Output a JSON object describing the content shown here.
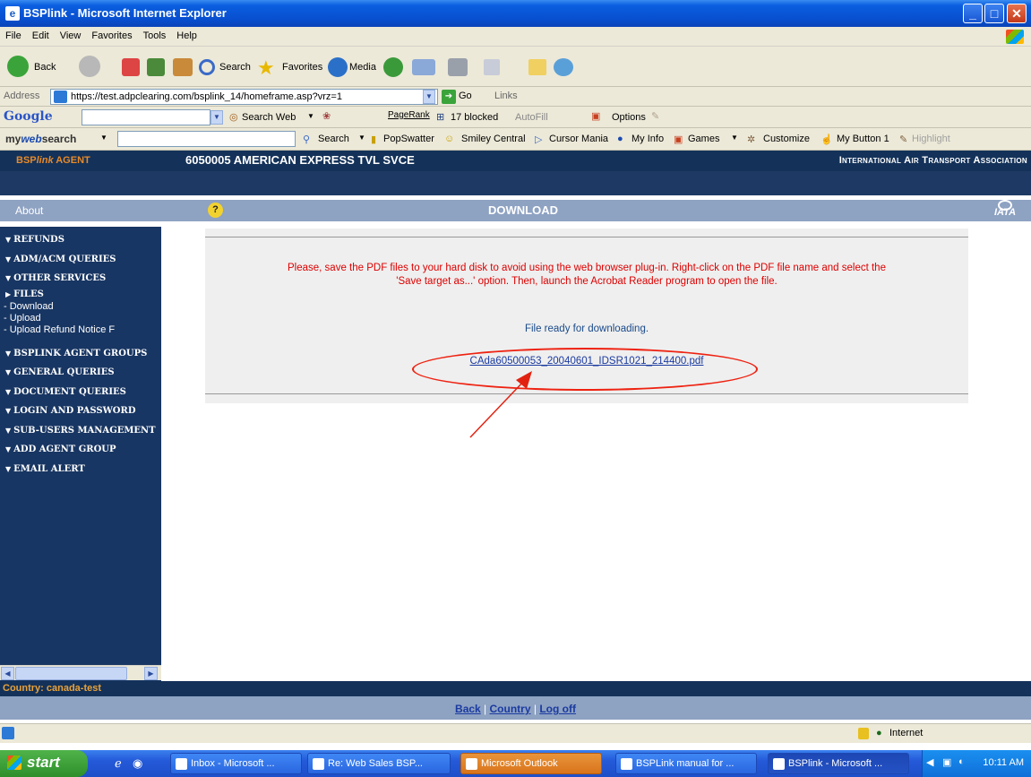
{
  "window": {
    "title": "BSPlink - Microsoft Internet Explorer"
  },
  "menu": {
    "items": [
      "File",
      "Edit",
      "View",
      "Favorites",
      "Tools",
      "Help"
    ]
  },
  "toolbar": {
    "back": "Back",
    "search": "Search",
    "favorites": "Favorites",
    "media": "Media"
  },
  "address": {
    "label": "Address",
    "url": "https://test.adpclearing.com/bsplink_14/homeframe.asp?vrz=1",
    "go": "Go",
    "links": "Links"
  },
  "google": {
    "logo": "Google",
    "search_web": "Search Web",
    "pagerank": "PageRank",
    "blocked": "17 blocked",
    "autofill": "AutoFill",
    "options": "Options"
  },
  "mywebsearch": {
    "logo_my": "my",
    "logo_web": "web",
    "logo_search": "search",
    "search": "Search",
    "items": [
      "PopSwatter",
      "Smiley Central",
      "Cursor Mania",
      "My Info",
      "Games",
      "Customize",
      "My Button 1",
      "Highlight"
    ]
  },
  "page": {
    "agent_label_prefix": "BSP",
    "agent_label_italic": "link",
    "agent_label_suffix": " AGENT",
    "agent_name": "6050005 AMERICAN EXPRESS TVL SVCE",
    "iata_name": "International Air Transport Association",
    "about": "About",
    "help": "?",
    "section_title": "DOWNLOAD",
    "iata_logo": "IATA"
  },
  "sidebar": {
    "items": [
      "REFUNDS",
      "ADM/ACM QUERIES",
      "OTHER SERVICES",
      "FILES"
    ],
    "files_sub": [
      "- Download",
      "- Upload",
      "- Upload Refund Notice F"
    ],
    "items2": [
      "BSPLINK AGENT GROUPS",
      "GENERAL QUERIES",
      "DOCUMENT QUERIES",
      "LOGIN AND PASSWORD",
      "SUB-USERS MANAGEMENT",
      "ADD AGENT GROUP",
      "EMAIL ALERT"
    ]
  },
  "content": {
    "notice_line1": "Please, save the PDF files to your hard disk to avoid using the web browser plug-in. Right-click on the PDF file name and select the",
    "notice_line2": "'Save target as...' option. Then, launch the Acrobat Reader program to open the file.",
    "ready": "File ready for downloading.",
    "file_link": "CAda60500053_20040601_IDSR1021_214400.pdf"
  },
  "footer": {
    "country": "Country: canada-test",
    "back": "Back",
    "country_link": "Country",
    "logoff": "Log off",
    "sep": " | "
  },
  "status": {
    "zone": "Internet"
  },
  "taskbar": {
    "start": "start",
    "tasks": [
      "Inbox - Microsoft ...",
      "Re: Web Sales BSP...",
      "Microsoft Outlook",
      "BSPLink manual for ...",
      "BSPlink - Microsoft ..."
    ],
    "clock": "10:11 AM"
  },
  "colors": {
    "navy": "#143259",
    "band": "#8ea2c2",
    "notice": "#dd0000",
    "annotation": "#e22211"
  }
}
